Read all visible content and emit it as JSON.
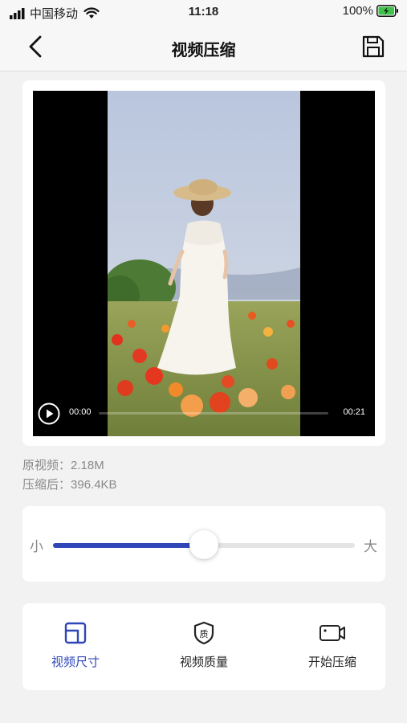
{
  "status_bar": {
    "carrier": "中国移动",
    "time": "11:18",
    "battery": "100%"
  },
  "nav": {
    "title": "视频压缩",
    "back_icon": "chevron-left-icon",
    "save_icon": "floppy-save-icon"
  },
  "player": {
    "current_time": "00:00",
    "duration": "00:21",
    "progress": 0
  },
  "info": {
    "original_label": "原视频：",
    "original_value": "2.18M",
    "compressed_label": "压缩后：",
    "compressed_value": "396.4KB"
  },
  "slider": {
    "min_label": "小",
    "max_label": "大",
    "value_fraction": 0.5
  },
  "tools": [
    {
      "label": "视频尺寸",
      "icon": "video-size-icon",
      "active": true
    },
    {
      "label": "视频质量",
      "icon": "quality-shield-icon",
      "icon_text": "质",
      "active": false
    },
    {
      "label": "开始压缩",
      "icon": "video-camera-icon",
      "active": false
    }
  ],
  "colors": {
    "accent": "#2e46b8",
    "background": "#f2f2f2",
    "card": "#ffffff",
    "muted_text": "#8a8a8a"
  }
}
